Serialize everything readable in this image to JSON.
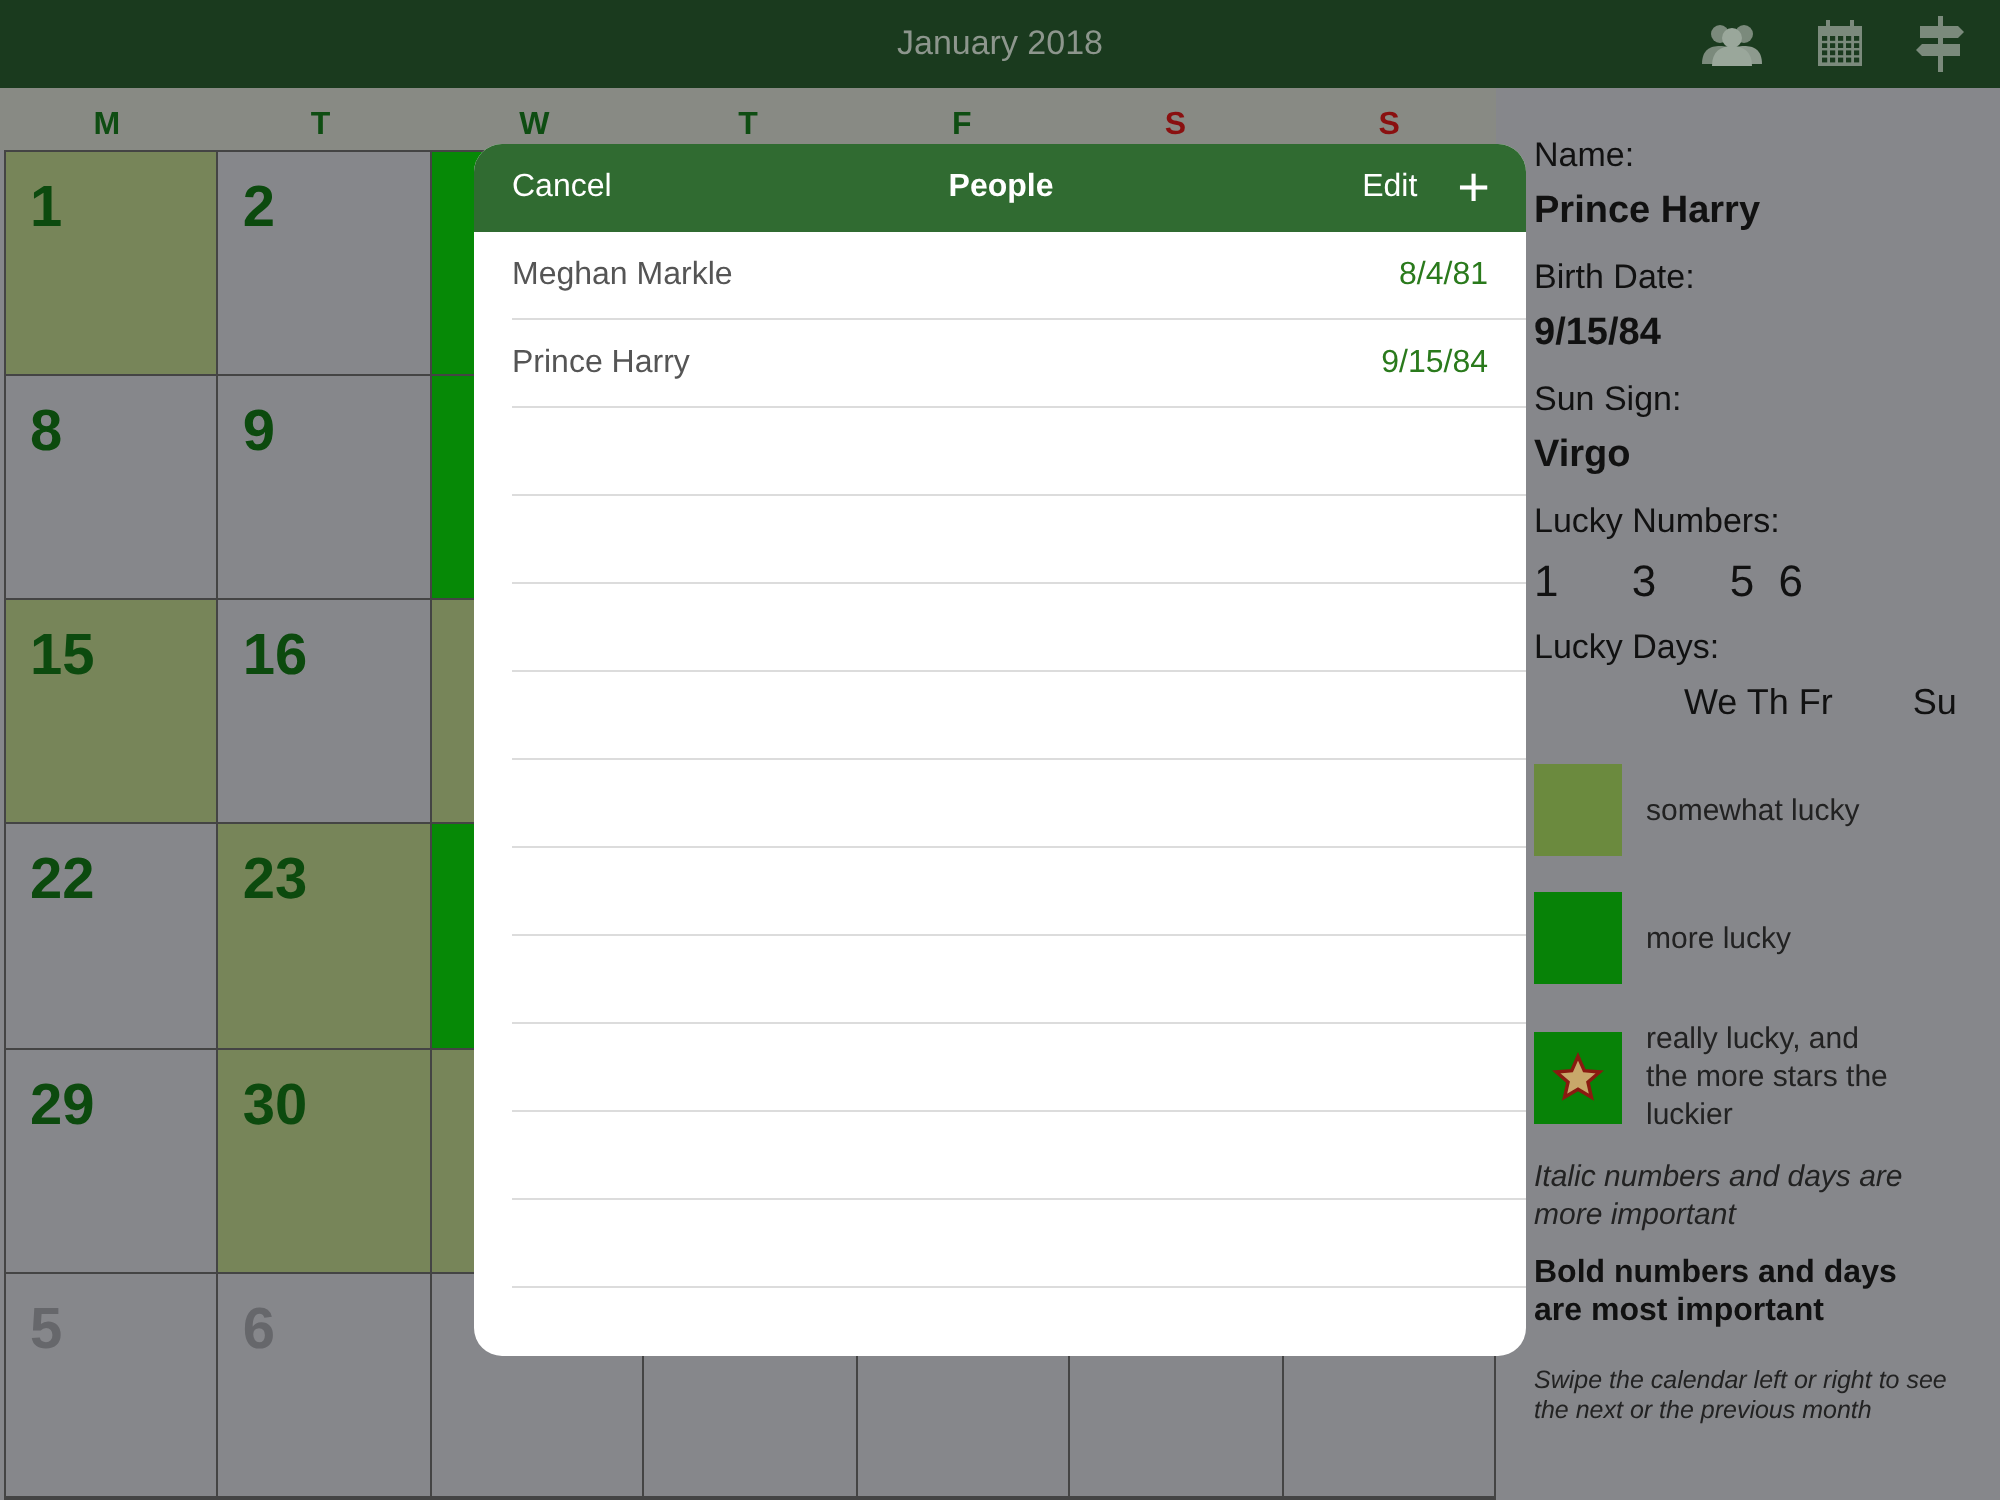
{
  "top_bar": {
    "title": "January 2018"
  },
  "weekdays": [
    {
      "label": "M",
      "weekend": false
    },
    {
      "label": "T",
      "weekend": false
    },
    {
      "label": "W",
      "weekend": false
    },
    {
      "label": "T",
      "weekend": false
    },
    {
      "label": "F",
      "weekend": false
    },
    {
      "label": "S",
      "weekend": true
    },
    {
      "label": "S",
      "weekend": true
    }
  ],
  "weeks": [
    [
      {
        "day": "1",
        "color": "#778559",
        "faded": false
      },
      {
        "day": "2",
        "color": "#86878b",
        "faded": false
      },
      {
        "color": "#068906"
      }
    ],
    [
      {
        "day": "8",
        "color": "#86878b",
        "faded": false
      },
      {
        "day": "9",
        "color": "#86878b",
        "faded": false
      },
      {
        "color": "#068906"
      }
    ],
    [
      {
        "day": "15",
        "color": "#778559",
        "faded": false
      },
      {
        "day": "16",
        "color": "#86878b",
        "faded": false
      },
      {
        "color": "#778559"
      }
    ],
    [
      {
        "day": "22",
        "color": "#86878b",
        "faded": false
      },
      {
        "day": "23",
        "color": "#778559",
        "faded": false
      },
      {
        "color": "#068906"
      }
    ],
    [
      {
        "day": "29",
        "color": "#86878b",
        "faded": false
      },
      {
        "day": "30",
        "color": "#778559",
        "faded": false
      },
      {
        "color": "#778559"
      }
    ],
    [
      {
        "day": "5",
        "color": "#86878b",
        "faded": true
      },
      {
        "day": "6",
        "color": "#86878b",
        "faded": true
      },
      {
        "color": "#86878b"
      }
    ]
  ],
  "details": {
    "name_label": "Name:",
    "name": "Prince Harry",
    "birth_label": "Birth Date:",
    "birth": "9/15/84",
    "sign_label": "Sun Sign:",
    "sign": "Virgo",
    "numbers_label": "Lucky Numbers:",
    "numbers": "1      3      5  6",
    "days_label": "Lucky Days:",
    "days": "We Th Fr        Su"
  },
  "legend": [
    {
      "kind": "plain",
      "color": "#6b8a3e",
      "label": "somewhat lucky"
    },
    {
      "kind": "plain",
      "color": "#078207",
      "label": "more lucky"
    },
    {
      "kind": "star",
      "color": "#078207",
      "label": "really lucky, and the more stars the luckier"
    }
  ],
  "notes": [
    {
      "kind": "italic",
      "text": "Italic numbers and days are more important"
    },
    {
      "kind": "bold",
      "text": "Bold numbers and days are most important"
    },
    {
      "kind": "hint",
      "text": "Swipe the calendar left or right to see the next or the previous month"
    }
  ],
  "people_sheet": {
    "cancel": "Cancel",
    "title": "People",
    "edit": "Edit",
    "add": "+",
    "rows": [
      {
        "name": "Meghan Markle",
        "date": "8/4/81"
      },
      {
        "name": "Prince Harry",
        "date": "9/15/84"
      }
    ]
  }
}
